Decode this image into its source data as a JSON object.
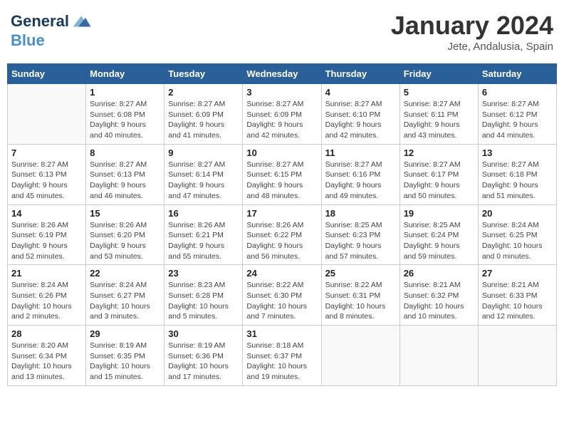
{
  "header": {
    "logo_line1": "General",
    "logo_line2": "Blue",
    "month": "January 2024",
    "location": "Jete, Andalusia, Spain"
  },
  "weekdays": [
    "Sunday",
    "Monday",
    "Tuesday",
    "Wednesday",
    "Thursday",
    "Friday",
    "Saturday"
  ],
  "weeks": [
    [
      {
        "day": "",
        "sunrise": "",
        "sunset": "",
        "daylight": ""
      },
      {
        "day": "1",
        "sunrise": "Sunrise: 8:27 AM",
        "sunset": "Sunset: 6:08 PM",
        "daylight": "Daylight: 9 hours and 40 minutes."
      },
      {
        "day": "2",
        "sunrise": "Sunrise: 8:27 AM",
        "sunset": "Sunset: 6:09 PM",
        "daylight": "Daylight: 9 hours and 41 minutes."
      },
      {
        "day": "3",
        "sunrise": "Sunrise: 8:27 AM",
        "sunset": "Sunset: 6:09 PM",
        "daylight": "Daylight: 9 hours and 42 minutes."
      },
      {
        "day": "4",
        "sunrise": "Sunrise: 8:27 AM",
        "sunset": "Sunset: 6:10 PM",
        "daylight": "Daylight: 9 hours and 42 minutes."
      },
      {
        "day": "5",
        "sunrise": "Sunrise: 8:27 AM",
        "sunset": "Sunset: 6:11 PM",
        "daylight": "Daylight: 9 hours and 43 minutes."
      },
      {
        "day": "6",
        "sunrise": "Sunrise: 8:27 AM",
        "sunset": "Sunset: 6:12 PM",
        "daylight": "Daylight: 9 hours and 44 minutes."
      }
    ],
    [
      {
        "day": "7",
        "sunrise": "Sunrise: 8:27 AM",
        "sunset": "Sunset: 6:13 PM",
        "daylight": "Daylight: 9 hours and 45 minutes."
      },
      {
        "day": "8",
        "sunrise": "Sunrise: 8:27 AM",
        "sunset": "Sunset: 6:13 PM",
        "daylight": "Daylight: 9 hours and 46 minutes."
      },
      {
        "day": "9",
        "sunrise": "Sunrise: 8:27 AM",
        "sunset": "Sunset: 6:14 PM",
        "daylight": "Daylight: 9 hours and 47 minutes."
      },
      {
        "day": "10",
        "sunrise": "Sunrise: 8:27 AM",
        "sunset": "Sunset: 6:15 PM",
        "daylight": "Daylight: 9 hours and 48 minutes."
      },
      {
        "day": "11",
        "sunrise": "Sunrise: 8:27 AM",
        "sunset": "Sunset: 6:16 PM",
        "daylight": "Daylight: 9 hours and 49 minutes."
      },
      {
        "day": "12",
        "sunrise": "Sunrise: 8:27 AM",
        "sunset": "Sunset: 6:17 PM",
        "daylight": "Daylight: 9 hours and 50 minutes."
      },
      {
        "day": "13",
        "sunrise": "Sunrise: 8:27 AM",
        "sunset": "Sunset: 6:18 PM",
        "daylight": "Daylight: 9 hours and 51 minutes."
      }
    ],
    [
      {
        "day": "14",
        "sunrise": "Sunrise: 8:26 AM",
        "sunset": "Sunset: 6:19 PM",
        "daylight": "Daylight: 9 hours and 52 minutes."
      },
      {
        "day": "15",
        "sunrise": "Sunrise: 8:26 AM",
        "sunset": "Sunset: 6:20 PM",
        "daylight": "Daylight: 9 hours and 53 minutes."
      },
      {
        "day": "16",
        "sunrise": "Sunrise: 8:26 AM",
        "sunset": "Sunset: 6:21 PM",
        "daylight": "Daylight: 9 hours and 55 minutes."
      },
      {
        "day": "17",
        "sunrise": "Sunrise: 8:26 AM",
        "sunset": "Sunset: 6:22 PM",
        "daylight": "Daylight: 9 hours and 56 minutes."
      },
      {
        "day": "18",
        "sunrise": "Sunrise: 8:25 AM",
        "sunset": "Sunset: 6:23 PM",
        "daylight": "Daylight: 9 hours and 57 minutes."
      },
      {
        "day": "19",
        "sunrise": "Sunrise: 8:25 AM",
        "sunset": "Sunset: 6:24 PM",
        "daylight": "Daylight: 9 hours and 59 minutes."
      },
      {
        "day": "20",
        "sunrise": "Sunrise: 8:24 AM",
        "sunset": "Sunset: 6:25 PM",
        "daylight": "Daylight: 10 hours and 0 minutes."
      }
    ],
    [
      {
        "day": "21",
        "sunrise": "Sunrise: 8:24 AM",
        "sunset": "Sunset: 6:26 PM",
        "daylight": "Daylight: 10 hours and 2 minutes."
      },
      {
        "day": "22",
        "sunrise": "Sunrise: 8:24 AM",
        "sunset": "Sunset: 6:27 PM",
        "daylight": "Daylight: 10 hours and 3 minutes."
      },
      {
        "day": "23",
        "sunrise": "Sunrise: 8:23 AM",
        "sunset": "Sunset: 6:28 PM",
        "daylight": "Daylight: 10 hours and 5 minutes."
      },
      {
        "day": "24",
        "sunrise": "Sunrise: 8:22 AM",
        "sunset": "Sunset: 6:30 PM",
        "daylight": "Daylight: 10 hours and 7 minutes."
      },
      {
        "day": "25",
        "sunrise": "Sunrise: 8:22 AM",
        "sunset": "Sunset: 6:31 PM",
        "daylight": "Daylight: 10 hours and 8 minutes."
      },
      {
        "day": "26",
        "sunrise": "Sunrise: 8:21 AM",
        "sunset": "Sunset: 6:32 PM",
        "daylight": "Daylight: 10 hours and 10 minutes."
      },
      {
        "day": "27",
        "sunrise": "Sunrise: 8:21 AM",
        "sunset": "Sunset: 6:33 PM",
        "daylight": "Daylight: 10 hours and 12 minutes."
      }
    ],
    [
      {
        "day": "28",
        "sunrise": "Sunrise: 8:20 AM",
        "sunset": "Sunset: 6:34 PM",
        "daylight": "Daylight: 10 hours and 13 minutes."
      },
      {
        "day": "29",
        "sunrise": "Sunrise: 8:19 AM",
        "sunset": "Sunset: 6:35 PM",
        "daylight": "Daylight: 10 hours and 15 minutes."
      },
      {
        "day": "30",
        "sunrise": "Sunrise: 8:19 AM",
        "sunset": "Sunset: 6:36 PM",
        "daylight": "Daylight: 10 hours and 17 minutes."
      },
      {
        "day": "31",
        "sunrise": "Sunrise: 8:18 AM",
        "sunset": "Sunset: 6:37 PM",
        "daylight": "Daylight: 10 hours and 19 minutes."
      },
      {
        "day": "",
        "sunrise": "",
        "sunset": "",
        "daylight": ""
      },
      {
        "day": "",
        "sunrise": "",
        "sunset": "",
        "daylight": ""
      },
      {
        "day": "",
        "sunrise": "",
        "sunset": "",
        "daylight": ""
      }
    ]
  ]
}
